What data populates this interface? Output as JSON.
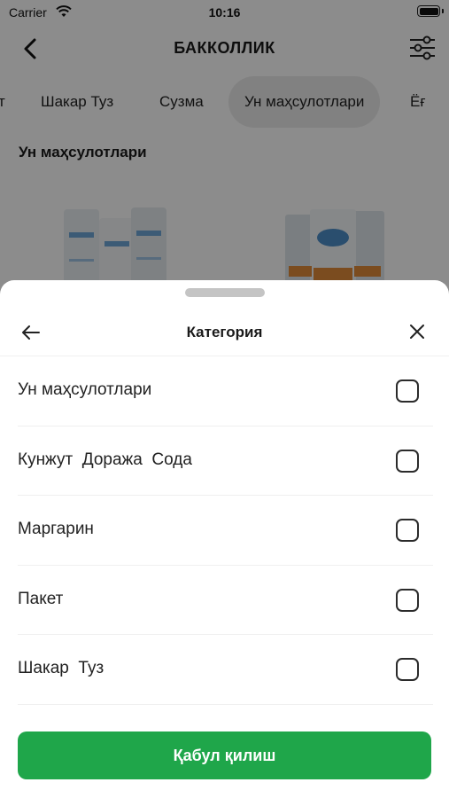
{
  "status_bar": {
    "carrier": "Carrier",
    "time": "10:16"
  },
  "nav": {
    "title": "БАККОЛЛИК",
    "back_icon": "chevron-left-icon",
    "filter_icon": "sliders-icon"
  },
  "tabs": [
    {
      "label": "т",
      "active": false
    },
    {
      "label": "Шакар  Туз",
      "active": false
    },
    {
      "label": "Сузма",
      "active": false
    },
    {
      "label": "Ун маҳсулотлари",
      "active": true
    },
    {
      "label": "Ёғ",
      "active": false
    }
  ],
  "section_title": "Ун маҳсулотлари",
  "sheet": {
    "title": "Категория",
    "back_icon": "arrow-left-icon",
    "close_icon": "close-icon",
    "options": [
      {
        "label": "Ун маҳсулотлари",
        "checked": false
      },
      {
        "label": "Кунжут  Доража  Сода",
        "checked": false
      },
      {
        "label": "Маргарин",
        "checked": false
      },
      {
        "label": "Пакет",
        "checked": false
      },
      {
        "label": "Шакар  Туз",
        "checked": false
      }
    ],
    "accept_label": "Қабул қилиш"
  },
  "colors": {
    "accent": "#1fa64a",
    "overlay": "rgba(0,0,0,0.45)"
  }
}
